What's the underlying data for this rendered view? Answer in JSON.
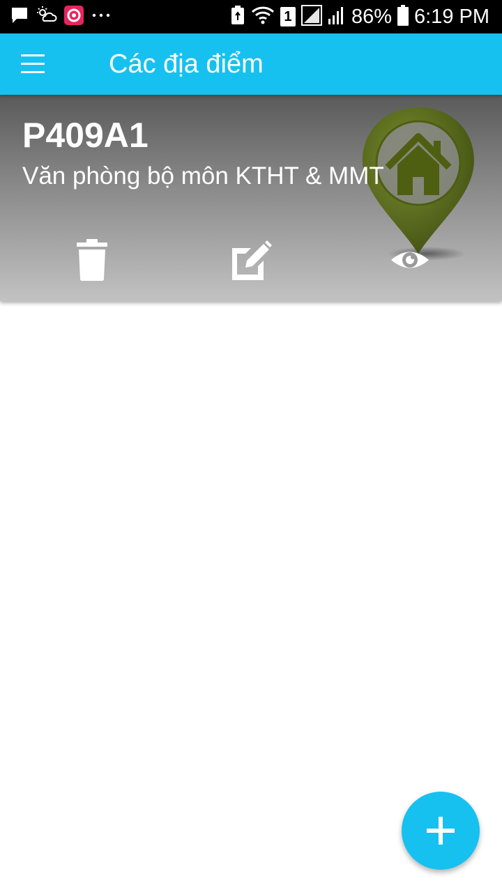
{
  "status_bar": {
    "battery_percent": "86%",
    "time": "6:19 PM",
    "sim_slot": "1",
    "left_icons": [
      "message-icon",
      "weather-icon",
      "app-notification-icon",
      "more-notifications-icon"
    ],
    "right_icons": [
      "battery-saver-icon",
      "wifi-icon",
      "sim-slot-icon",
      "signal-sim1-icon",
      "signal-sim2-icon",
      "battery-icon"
    ]
  },
  "app_bar": {
    "title": "Các địa điểm",
    "menu_icon": "hamburger-menu-icon",
    "background_color": "#16C1F0"
  },
  "places": [
    {
      "code": "P409A1",
      "description": "Văn phòng bộ môn KTHT & MMT",
      "image_icon": "home-location-pin-icon",
      "actions": [
        "delete-icon",
        "edit-icon",
        "view-icon"
      ]
    }
  ],
  "fab": {
    "icon": "plus-icon",
    "color": "#16C1F0"
  }
}
